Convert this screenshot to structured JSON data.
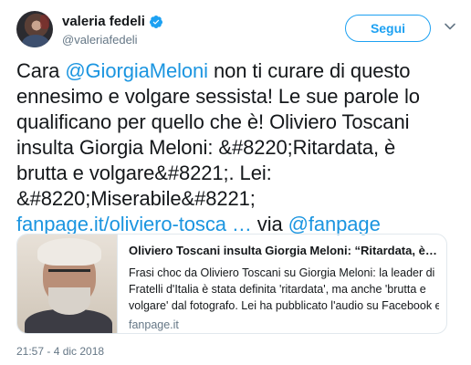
{
  "user": {
    "display_name": "valeria fedeli",
    "handle": "@valeriafedeli"
  },
  "follow_button": {
    "label": "Segui"
  },
  "tweet": {
    "lines": [
      {
        "pre": "Cara ",
        "mention": "@GiorgiaMeloni",
        "post": " non ti curare di questo"
      },
      {
        "text": "ennesimo e volgare sessista! Le sue parole lo"
      },
      {
        "text": "qualificano per quello che è! Oliviero Toscani"
      },
      {
        "text": "insulta Giorgia Meloni: &#8220;Ritardata, è"
      },
      {
        "text": "brutta e volgare&#8221;. Lei:"
      },
      {
        "text": "&#8220;Miserabile&#8221;"
      },
      {
        "link": "fanpage.it/oliviero-tosca …",
        "mid": " via ",
        "via": "@fanpage"
      }
    ]
  },
  "card": {
    "title": "Oliviero Toscani insulta Giorgia Meloni: “Ritardata, è brutta …",
    "description_lines": [
      "Frasi choc da Oliviero Toscani su Giorgia Meloni: la leader di",
      "Fratelli d'Italia è stata definita 'ritardata', ma anche 'brutta e",
      "volgare' dal fotografo. Lei ha pubblicato l'audio su Facebook e"
    ],
    "domain": "fanpage.it"
  },
  "timestamp": "21:57 - 4 dic 2018",
  "colors": {
    "accent": "#1da1f2",
    "link": "#1b95e0",
    "secondary_text": "#657786"
  },
  "icons": {
    "verified": "verified-badge-icon",
    "menu": "chevron-down-icon"
  }
}
